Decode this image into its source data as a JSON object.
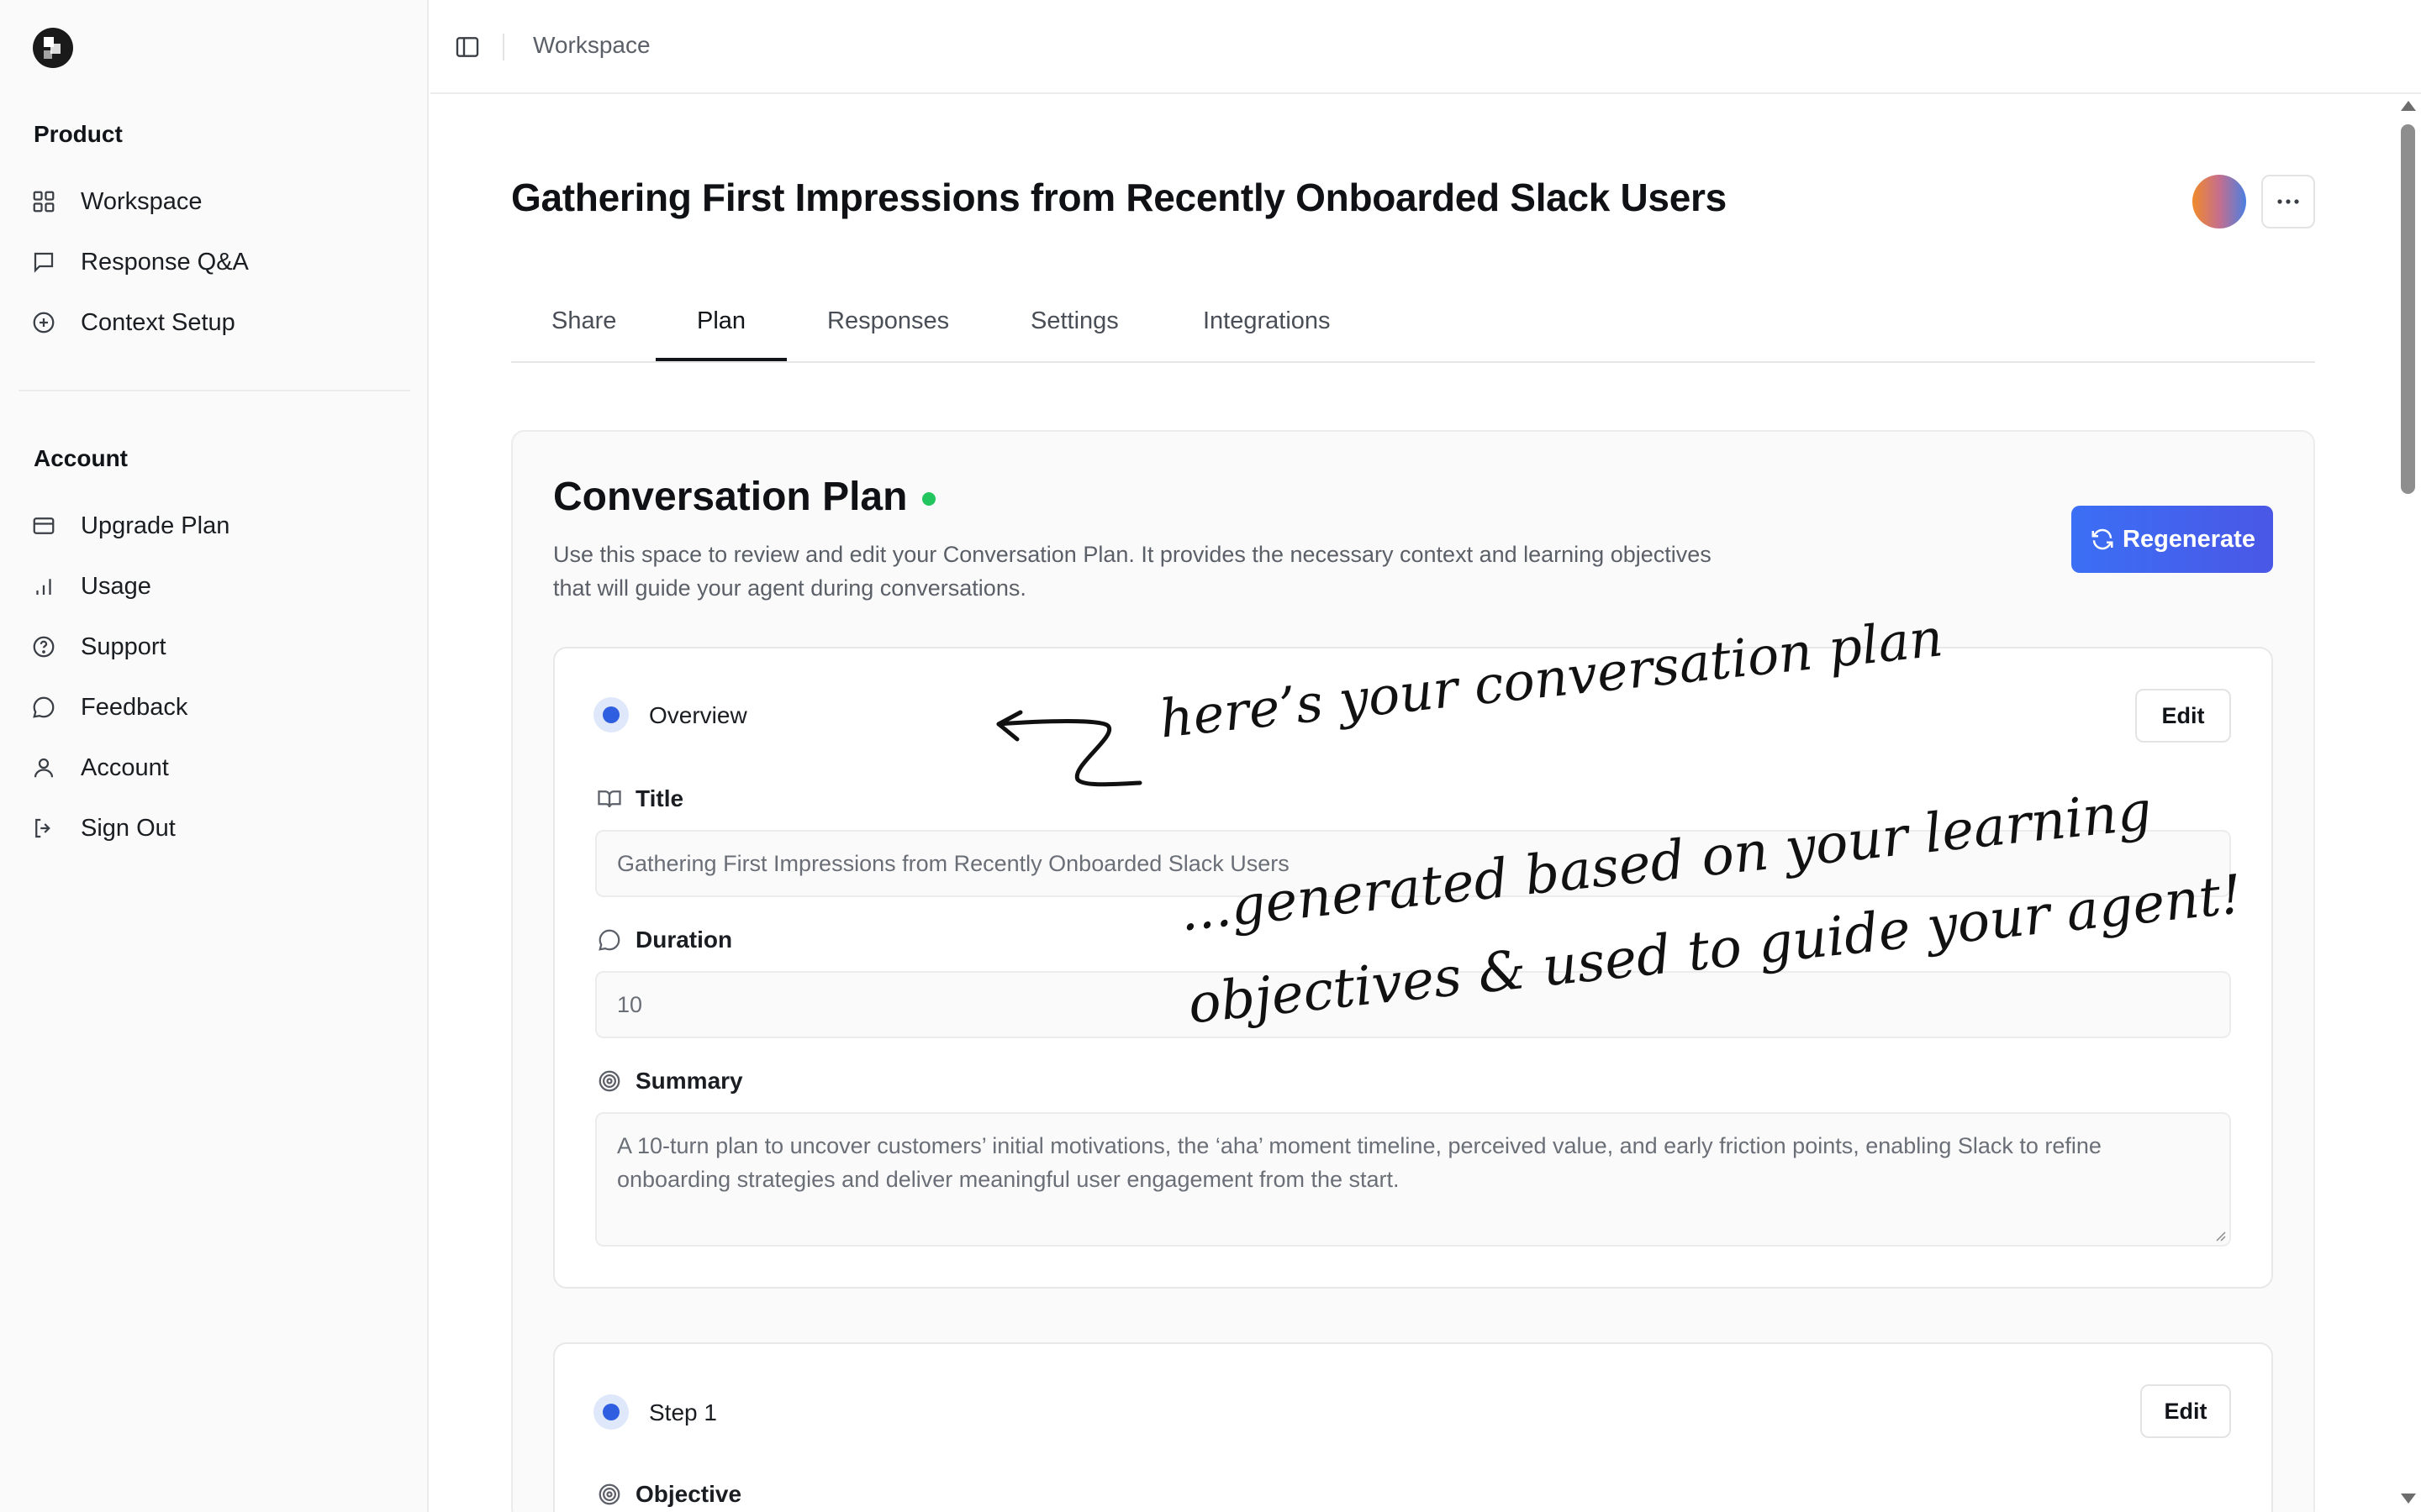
{
  "sidebar": {
    "sections": [
      {
        "label": "Product",
        "items": [
          {
            "label": "Workspace",
            "icon": "grid-icon"
          },
          {
            "label": "Response Q&A",
            "icon": "message-square-icon"
          },
          {
            "label": "Context Setup",
            "icon": "plus-circle-icon"
          }
        ]
      },
      {
        "label": "Account",
        "items": [
          {
            "label": "Upgrade Plan",
            "icon": "credit-card-icon"
          },
          {
            "label": "Usage",
            "icon": "bar-chart-icon"
          },
          {
            "label": "Support",
            "icon": "help-circle-icon"
          },
          {
            "label": "Feedback",
            "icon": "message-circle-icon"
          },
          {
            "label": "Account",
            "icon": "user-icon"
          },
          {
            "label": "Sign Out",
            "icon": "log-out-icon"
          }
        ]
      }
    ]
  },
  "topbar": {
    "breadcrumb": "Workspace"
  },
  "page": {
    "title": "Gathering First Impressions from Recently Onboarded Slack Users",
    "tabs": [
      {
        "label": "Share",
        "active": false
      },
      {
        "label": "Plan",
        "active": true
      },
      {
        "label": "Responses",
        "active": false
      },
      {
        "label": "Settings",
        "active": false
      },
      {
        "label": "Integrations",
        "active": false
      }
    ]
  },
  "plan": {
    "title": "Conversation Plan",
    "status_color": "#22c55e",
    "description": "Use this space to review and edit your Conversation Plan. It provides the necessary context and learning objectives that will guide your agent during conversations.",
    "regenerate_label": "Regenerate",
    "overview": {
      "label": "Overview",
      "edit_label": "Edit",
      "fields": {
        "title_label": "Title",
        "title_value": "Gathering First Impressions from Recently Onboarded Slack Users",
        "duration_label": "Duration",
        "duration_value": "10",
        "summary_label": "Summary",
        "summary_value": "A 10-turn plan to uncover customers’ initial motivations, the ‘aha’ moment timeline, perceived value, and early friction points, enabling Slack to refine onboarding strategies and deliver meaningful user engagement from the start."
      }
    },
    "step1": {
      "label": "Step 1",
      "edit_label": "Edit",
      "objective_label": "Objective"
    }
  },
  "annotations": {
    "line1": "here’s your conversation plan",
    "line2": "...generated based on your learning",
    "line3": "objectives & used to guide your agent!"
  },
  "colors": {
    "accent": "#3b6ff5",
    "status_green": "#22c55e"
  }
}
